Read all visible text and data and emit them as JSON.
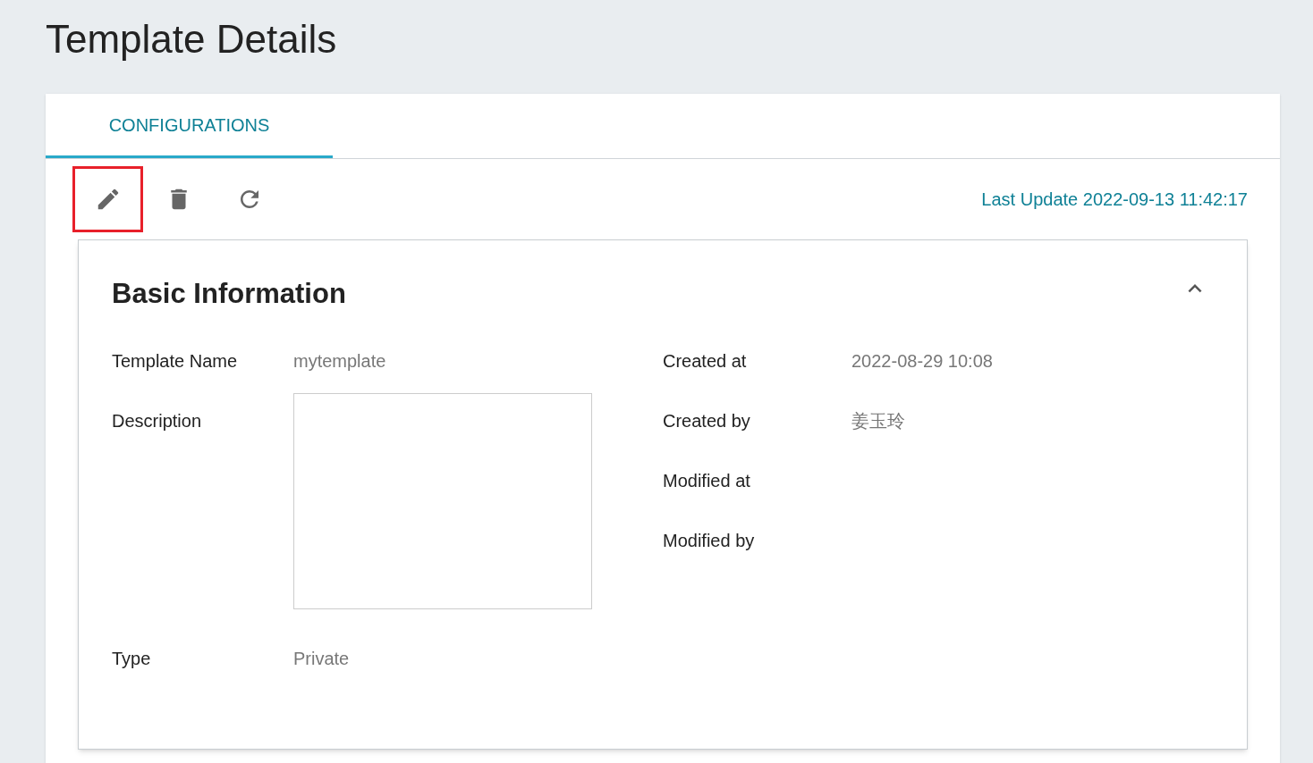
{
  "page_title": "Template Details",
  "tabs": [
    {
      "label": "CONFIGURATIONS",
      "selected": true
    }
  ],
  "toolbar": {
    "buttons": [
      {
        "kind": "edit",
        "highlighted": true
      },
      {
        "kind": "delete",
        "highlighted": false
      },
      {
        "kind": "refresh",
        "highlighted": false
      }
    ],
    "last_update": "Last Update 2022-09-13 11:42:17"
  },
  "section": {
    "title": "Basic Information",
    "expanded": true,
    "left_fields": [
      {
        "label": "Template Name",
        "value": "mytemplate",
        "kind": "text"
      },
      {
        "label": "Description",
        "kind": "textarea"
      },
      {
        "label": "Type",
        "value": "Private",
        "kind": "text"
      }
    ],
    "right_fields": [
      {
        "label": "Created at",
        "value": "2022-08-29 10:08"
      },
      {
        "label": "Created by",
        "value": "姜玉玲"
      },
      {
        "label": "Modified at"
      },
      {
        "label": "Modified by"
      }
    ]
  }
}
